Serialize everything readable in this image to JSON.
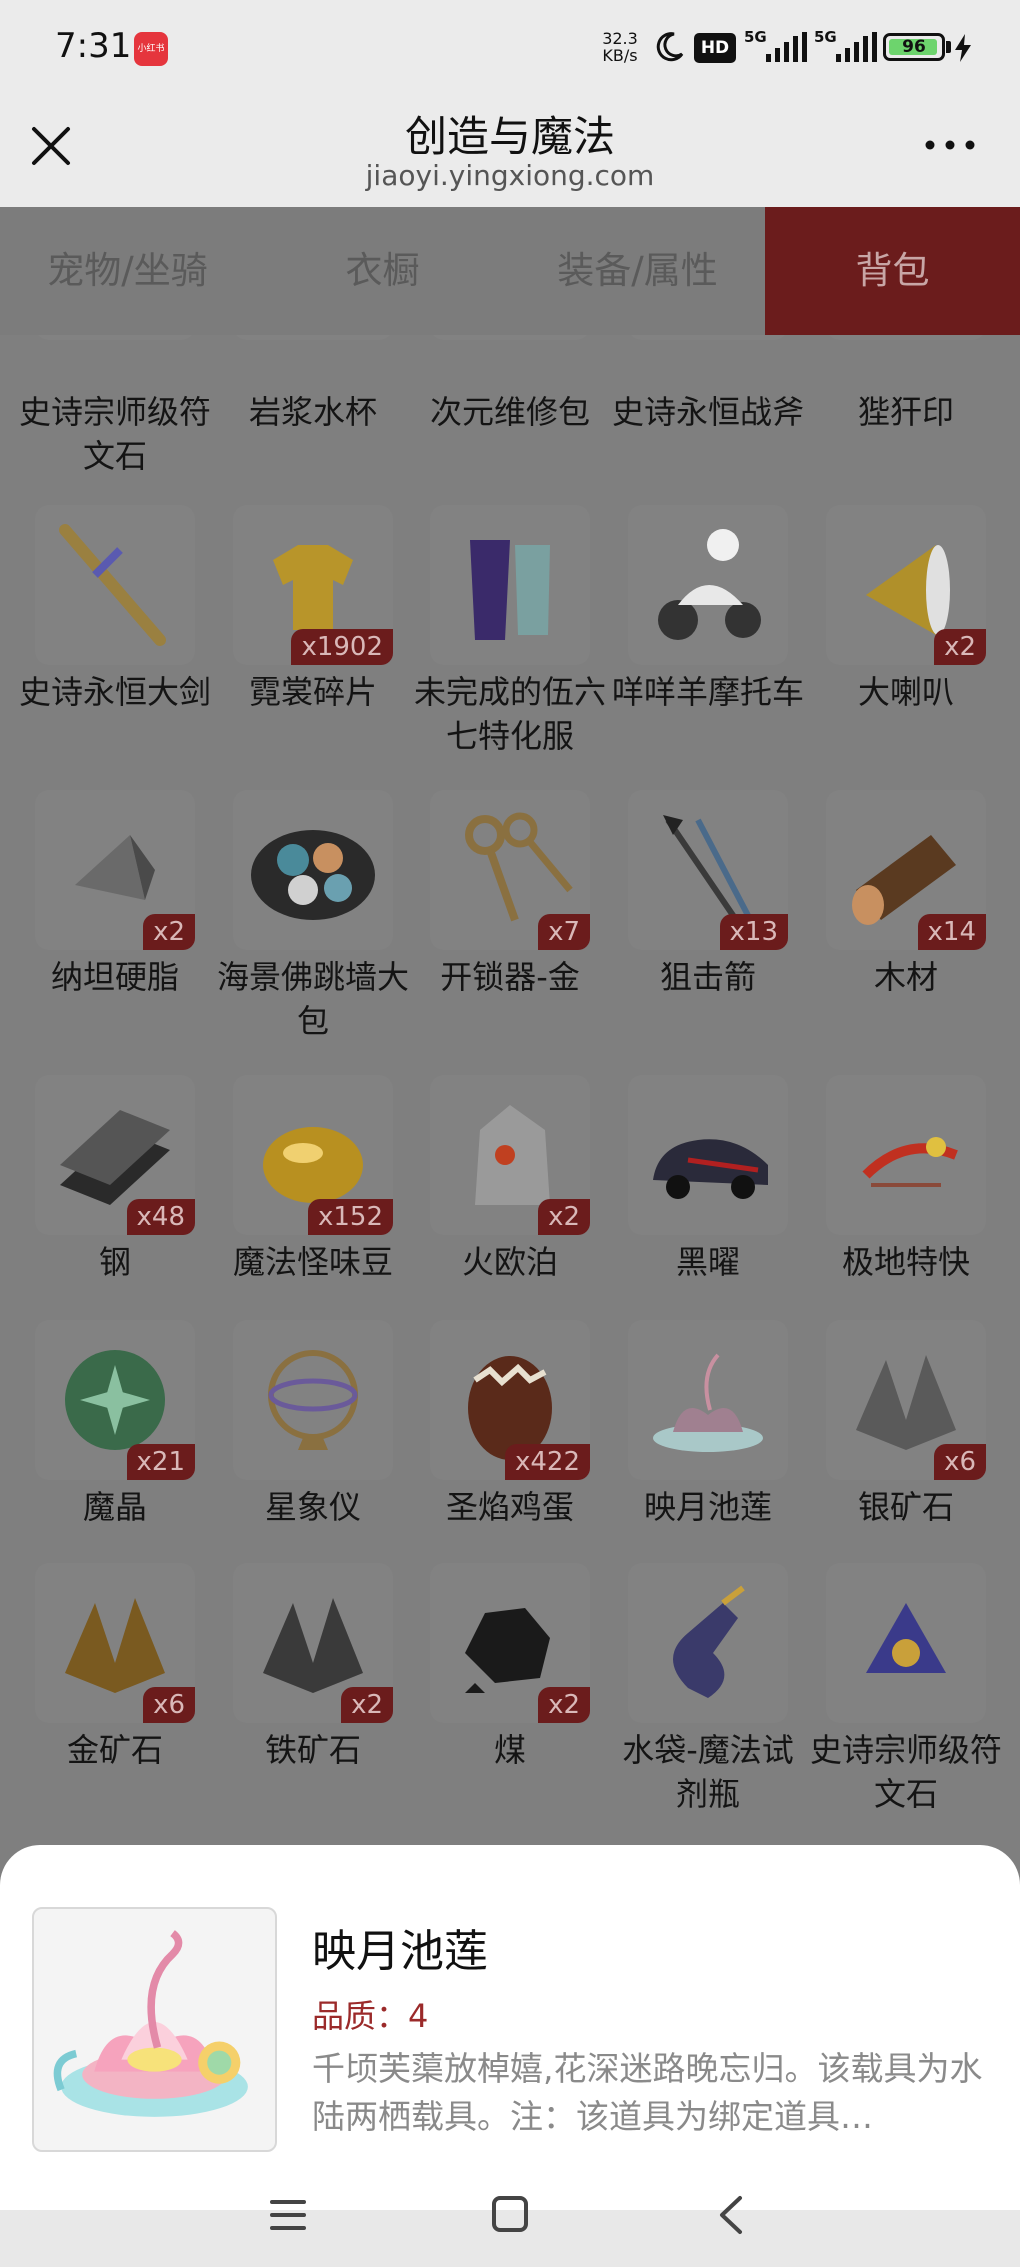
{
  "status_bar": {
    "time": "7:31",
    "app_badge": "小红书",
    "net_speed_value": "32.3",
    "net_speed_unit": "KB/s",
    "hd_label": "HD",
    "signal1_label": "5G",
    "signal2_label": "5G",
    "battery": "96",
    "battery_level": 0.96
  },
  "header": {
    "title": "创造与魔法",
    "url": "jiaoyi.yingxiong.com"
  },
  "tabs": [
    {
      "label": "宠物/坐骑",
      "active": false
    },
    {
      "label": "衣橱",
      "active": false
    },
    {
      "label": "装备/属性",
      "active": false
    },
    {
      "label": "背包",
      "active": true
    }
  ],
  "items": [
    {
      "name": "史诗宗师级符文石",
      "count": "",
      "icon": "rune-stone-icon",
      "color": "#4a4a8a"
    },
    {
      "name": "岩浆水杯",
      "count": "",
      "icon": "magma-cup-icon",
      "color": "#b8a060"
    },
    {
      "name": "次元维修包",
      "count": "",
      "icon": "repair-kit-icon",
      "color": "#6b4a2a"
    },
    {
      "name": "史诗永恒战斧",
      "count": "",
      "icon": "battle-axe-icon",
      "color": "#4a6aa0"
    },
    {
      "name": "狴犴印",
      "count": "",
      "icon": "seal-icon",
      "color": "#4a8a7a"
    },
    {
      "name": "史诗永恒大剑",
      "count": "",
      "icon": "greatsword-icon",
      "color": "#9a8040"
    },
    {
      "name": "霓裳碎片",
      "count": "x1902",
      "icon": "cloth-shard-icon",
      "color": "#b8952a"
    },
    {
      "name": "未完成的伍六七特化服",
      "count": "",
      "icon": "costume-icon",
      "color": "#3a2a6a"
    },
    {
      "name": "咩咩羊摩托车",
      "count": "",
      "icon": "motorbike-icon",
      "color": "#8a8a8a"
    },
    {
      "name": "大喇叭",
      "count": "x2",
      "icon": "megaphone-icon",
      "color": "#b0902a"
    },
    {
      "name": "纳坦硬脂",
      "count": "x2",
      "icon": "hard-fat-icon",
      "color": "#6a6a6a"
    },
    {
      "name": "海景佛跳墙大包",
      "count": "",
      "icon": "food-bowl-icon",
      "color": "#3a6a6a"
    },
    {
      "name": "开锁器-金",
      "count": "x7",
      "icon": "keys-icon",
      "color": "#8a7040"
    },
    {
      "name": "狙击箭",
      "count": "x13",
      "icon": "arrows-icon",
      "color": "#3a3a3a"
    },
    {
      "name": "木材",
      "count": "x14",
      "icon": "wood-log-icon",
      "color": "#5a3a20"
    },
    {
      "name": "钢",
      "count": "x48",
      "icon": "steel-ingot-icon",
      "color": "#2a2a2a"
    },
    {
      "name": "魔法怪味豆",
      "count": "x152",
      "icon": "magic-bean-icon",
      "color": "#b89020"
    },
    {
      "name": "火欧泊",
      "count": "x2",
      "icon": "fire-opal-icon",
      "color": "#9a9a9a"
    },
    {
      "name": "黑曜",
      "count": "",
      "icon": "black-car-icon",
      "color": "#2a2a3a"
    },
    {
      "name": "极地特快",
      "count": "",
      "icon": "sleigh-icon",
      "color": "#8a4a3a"
    },
    {
      "name": "魔晶",
      "count": "x21",
      "icon": "magic-crystal-icon",
      "color": "#3a6a4a"
    },
    {
      "name": "星象仪",
      "count": "",
      "icon": "astrolabe-icon",
      "color": "#8a7040"
    },
    {
      "name": "圣焰鸡蛋",
      "count": "x422",
      "icon": "egg-icon",
      "color": "#5a2a1a"
    },
    {
      "name": "映月池莲",
      "count": "",
      "icon": "lotus-icon",
      "color": "#a08090"
    },
    {
      "name": "银矿石",
      "count": "x6",
      "icon": "silver-ore-icon",
      "color": "#5a5a5a"
    },
    {
      "name": "金矿石",
      "count": "x6",
      "icon": "gold-ore-icon",
      "color": "#7a5a20"
    },
    {
      "name": "铁矿石",
      "count": "x2",
      "icon": "iron-ore-icon",
      "color": "#3a3a3a"
    },
    {
      "name": "煤",
      "count": "x2",
      "icon": "coal-icon",
      "color": "#1a1a1a"
    },
    {
      "name": "水袋-魔法试剂瓶",
      "count": "",
      "icon": "potion-bottle-icon",
      "color": "#3a3a6a"
    },
    {
      "name": "史诗宗师级符文石",
      "count": "",
      "icon": "rune-stone-icon",
      "color": "#3a3a8a"
    }
  ],
  "detail": {
    "title": "映月池莲",
    "quality_label": "品质：",
    "quality_value": "4",
    "description": "千顷芙蕖放棹嬉,花深迷路晚忘归。该载具为水陆两栖载具。注：该道具为绑定道具…",
    "icon": "lotus-icon"
  },
  "navbar": {
    "menu_icon": "menu-icon",
    "home_icon": "home-icon",
    "back_icon": "back-icon"
  }
}
